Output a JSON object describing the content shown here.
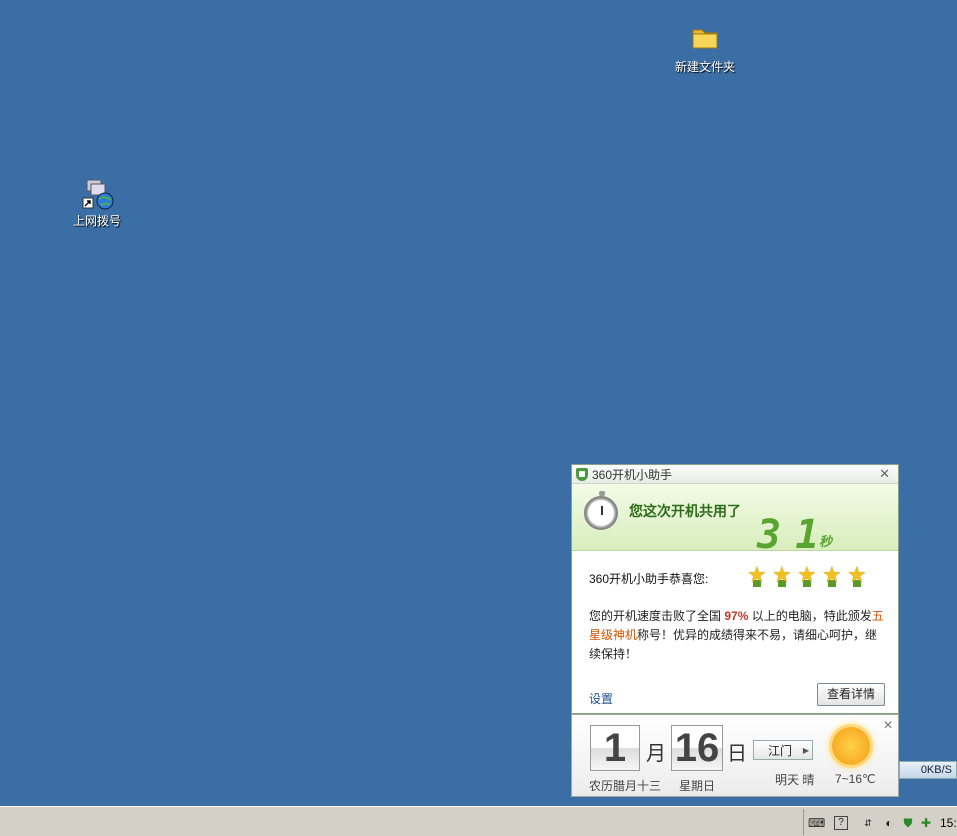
{
  "desktop": {
    "icons": [
      {
        "label": "新建文件夹",
        "icon": "folder-icon"
      },
      {
        "label": "上网拨号",
        "icon": "network-dialup-icon"
      }
    ]
  },
  "popup": {
    "title": "360开机小助手",
    "close": "✕",
    "banner_msg": "您这次开机共用了",
    "seconds": "31",
    "seconds_unit": "秒",
    "congrats": "360开机小助手恭喜您:",
    "stars": 5,
    "para_1": "您的开机速度击败了全国",
    "percent": "97%",
    "para_2": "以上的电脑，特此颁发",
    "title_award": "五星级神机",
    "para_3": "称号！优异的成绩得来不易，请细心呵护，继续保持！",
    "settings_link": "设置",
    "details_button": "查看详情"
  },
  "calendar": {
    "month": "1",
    "month_label": "月",
    "day": "16",
    "day_label": "日",
    "lunar": "农历腊月十三",
    "weekday": "星期日",
    "city": "江门",
    "tomorrow": "明天 晴",
    "temp": "7~16℃",
    "close": "✕",
    "weather_icon": "sun-icon"
  },
  "network_speed": "0KB/S",
  "taskbar": {
    "clock": "15:"
  },
  "colors": {
    "desktop": "#3a6ea5",
    "banner_green": "#5aa530",
    "highlight_red": "#c0392b"
  }
}
